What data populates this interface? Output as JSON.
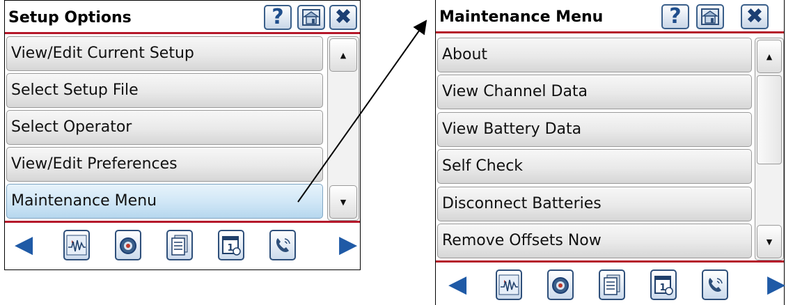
{
  "left_panel": {
    "title": "Setup Options",
    "menu_items": [
      "View/Edit Current Setup",
      "Select Setup File",
      "Select Operator",
      "View/Edit Preferences",
      "Maintenance Menu"
    ],
    "selected_item": "Maintenance Menu"
  },
  "right_panel": {
    "title": "Maintenance Menu",
    "menu_items": [
      "About",
      "View Channel Data",
      "View Battery Data",
      "Self Check",
      "Disconnect Batteries",
      "Remove Offsets Now"
    ]
  },
  "toolbar": {
    "help_glyph": "?",
    "close_glyph": "✖",
    "icons": [
      "help-icon",
      "home-icon",
      "close-icon"
    ]
  },
  "scrollbar": {
    "up_glyph": "▲",
    "down_glyph": "▼"
  },
  "bottom_nav": {
    "prev_glyph": "◀",
    "next_glyph": "▶",
    "icons": [
      "waveform-icon",
      "gauge-icon",
      "documents-icon",
      "calendar-icon",
      "phone-icon"
    ]
  },
  "colors": {
    "accent": "#b5172a",
    "icon_blue": "#1f5aa6",
    "selected_bg": "#cfe6f6"
  }
}
